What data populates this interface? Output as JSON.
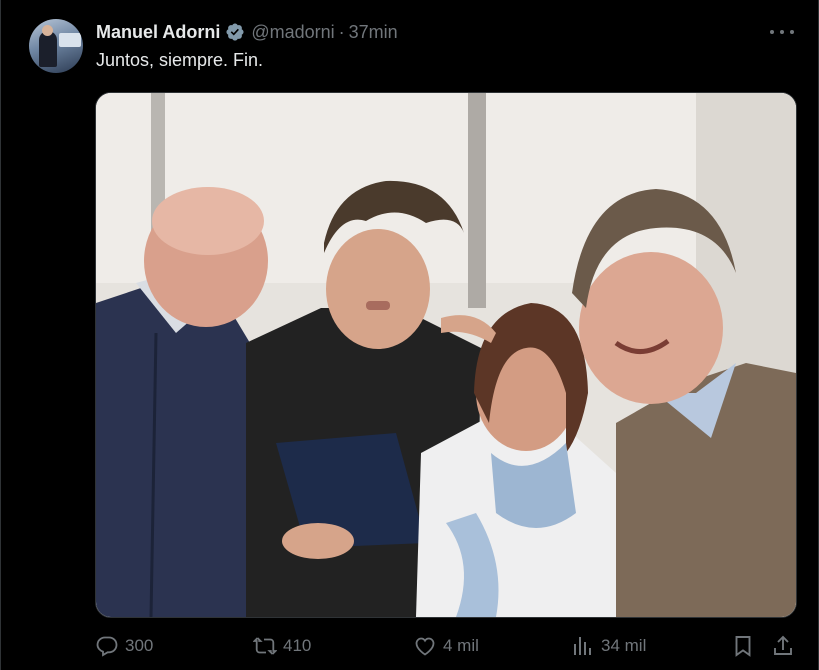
{
  "tweet": {
    "author_name": "Manuel Adorni",
    "handle": "@madorni",
    "separator": "·",
    "time": "37min",
    "text": "Juntos, siempre. Fin.",
    "avatar_icon": "profile-avatar",
    "verified_icon": "verified-badge-icon",
    "verified_color": "#829aab"
  },
  "actions": {
    "replies": "300",
    "reposts": "410",
    "likes": "4 mil",
    "views": "34 mil"
  },
  "colors": {
    "background": "#000000",
    "text_primary": "#e7e9ea",
    "text_secondary": "#71767b",
    "border": "#2f3336"
  }
}
